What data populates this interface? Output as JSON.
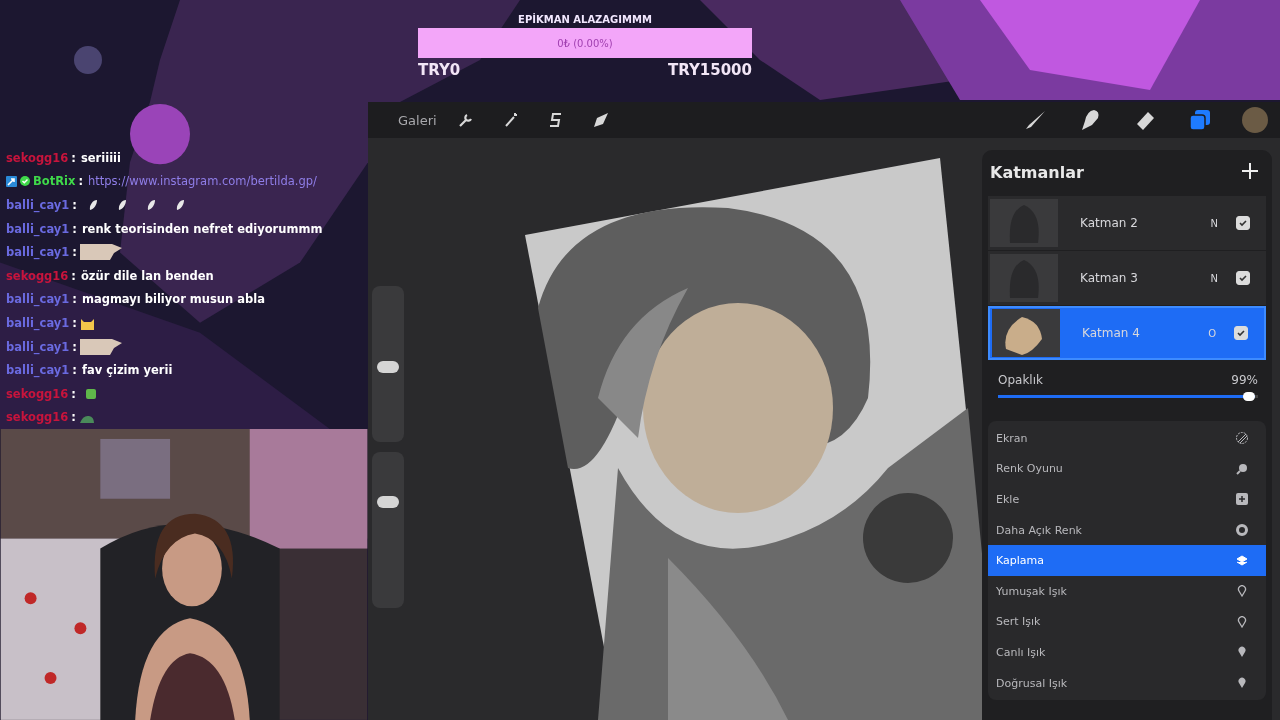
{
  "goal": {
    "title": "EPİKMAN ALAZAGIMMM",
    "progress_text": "0₺ (0.00%)",
    "level": 0,
    "min_label": "TRY0",
    "max_label": "TRY15000"
  },
  "chat": [
    {
      "user": "sekogg16",
      "color": "#c8143c",
      "sep": ":",
      "kind": "text",
      "text": "seriiiii"
    },
    {
      "user": "BotRix",
      "color": "#3fd94a",
      "sep": ":",
      "kind": "link",
      "text": "https://www.instagram.com/bertilda.gp/",
      "badges": [
        {
          "kind": "bot"
        },
        {
          "kind": "verified"
        }
      ]
    },
    {
      "user": "balli_cay1",
      "color": "#6a6ae0",
      "sep": ":",
      "kind": "emotes",
      "emotes": [
        {
          "kind": "feather"
        },
        {
          "kind": "feather"
        },
        {
          "kind": "feather"
        },
        {
          "kind": "feather"
        }
      ]
    },
    {
      "user": "balli_cay1",
      "color": "#6a6ae0",
      "sep": ":",
      "kind": "text",
      "text": "renk teorisinden nefret ediyorummm"
    },
    {
      "user": "balli_cay1",
      "color": "#6a6ae0",
      "sep": ":",
      "kind": "emotes",
      "emotes": [
        {
          "kind": "hand"
        }
      ]
    },
    {
      "user": "sekogg16",
      "color": "#c8143c",
      "sep": ":",
      "kind": "text",
      "text": "özür dile lan benden"
    },
    {
      "user": "balli_cay1",
      "color": "#6a6ae0",
      "sep": ":",
      "kind": "text",
      "text": "magmayı biliyor musun abla"
    },
    {
      "user": "balli_cay1",
      "color": "#6a6ae0",
      "sep": ":",
      "kind": "emotes",
      "emotes": [
        {
          "kind": "cat"
        }
      ]
    },
    {
      "user": "balli_cay1",
      "color": "#6a6ae0",
      "sep": ":",
      "kind": "emotes",
      "emotes": [
        {
          "kind": "hand"
        }
      ]
    },
    {
      "user": "balli_cay1",
      "color": "#6a6ae0",
      "sep": ":",
      "kind": "text",
      "text": "fav çizim yerii"
    },
    {
      "user": "sekogg16",
      "color": "#c8143c",
      "sep": ":",
      "kind": "emotes",
      "emotes": [
        {
          "kind": "frog"
        }
      ]
    },
    {
      "user": "sekogg16",
      "color": "#c8143c",
      "sep": ":",
      "kind": "emotes",
      "emotes": [
        {
          "kind": "snail"
        }
      ]
    }
  ],
  "toolbar": {
    "gallery": "Galeri",
    "left_tools": [
      {
        "kind": "wrench"
      },
      {
        "kind": "wand"
      },
      {
        "kind": "s"
      },
      {
        "kind": "arrow"
      }
    ],
    "right_tools": [
      {
        "kind": "brush",
        "selected": false
      },
      {
        "kind": "smudge",
        "selected": false
      },
      {
        "kind": "eraser",
        "selected": false
      },
      {
        "kind": "layers",
        "selected": true
      }
    ]
  },
  "side_sliders": [
    {
      "level": 0.48
    },
    {
      "level": 0.68
    }
  ],
  "layers_panel": {
    "title": "Katmanlar",
    "layers": [
      {
        "name": "Katman 2",
        "blend": "N",
        "visible": true,
        "selected": false
      },
      {
        "name": "Katman 3",
        "blend": "N",
        "visible": true,
        "selected": false
      },
      {
        "name": "Katman 4",
        "blend": "O",
        "visible": true,
        "selected": true
      }
    ],
    "opacity": {
      "label": "Opaklık",
      "reading": "99%",
      "level": 0.99
    },
    "blend_modes": [
      {
        "name": "Ekran",
        "kind": "hatch",
        "selected": false
      },
      {
        "name": "Renk Oyunu",
        "kind": "burn",
        "selected": false
      },
      {
        "name": "Ekle",
        "kind": "plus",
        "selected": false
      },
      {
        "name": "Daha Açık Renk",
        "kind": "ring",
        "selected": false
      },
      {
        "name": "Kaplama",
        "kind": "stack",
        "selected": true
      },
      {
        "name": "Yumuşak Işık",
        "kind": "bulb",
        "selected": false
      },
      {
        "name": "Sert Işık",
        "kind": "bulb",
        "selected": false
      },
      {
        "name": "Canlı Işık",
        "kind": "bulbfill",
        "selected": false
      },
      {
        "name": "Doğrusal Işık",
        "kind": "bulbfill",
        "selected": false
      }
    ]
  }
}
